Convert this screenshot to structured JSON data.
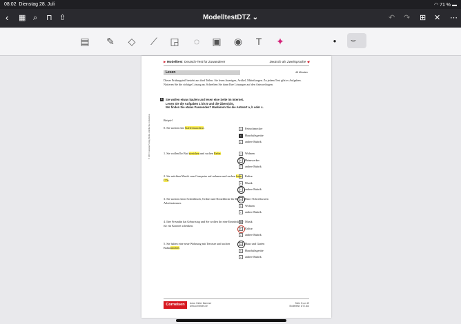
{
  "status": {
    "time": "08:02",
    "date": "Dienstag 28. Juli",
    "battery": "71 %"
  },
  "nav": {
    "title": "ModelltestDTZ",
    "title_chevron": "⌄"
  },
  "header": {
    "left_bold": "Modelltest",
    "left_text": "Deutsch-Test für Zuwanderer",
    "right": "Deutsch als Zweitsprache"
  },
  "section": {
    "title": "Lesen",
    "minutes": "45 Minuten"
  },
  "intro": "Dieser Prüfungsteil besteht aus fünf Teilen. Sie lesen Anzeigen, Artikel, Mitteilungen. Zu jedem Text gibt es Aufgaben. Notieren Sie die richtige Lösung an. Schreiben Sie dann Ihre Lösungen auf den Antwortbogen.",
  "task": {
    "number": "1",
    "line1": "Sie wollen etwas kaufen und lesen eine Seite im Internet.",
    "line2": "Lesen Sie die Aufgaben 1 bis 5 und die Übersicht.",
    "line3": "Wo finden Sie etwas Passendes? Markieren Sie die Antwort a, b oder c."
  },
  "beispiel": "Beispiel",
  "side_text": "© 2009 Cornelsen Verlag, Berlin. Alle Rechte vorbehalten.",
  "questions": [
    {
      "pre": "0.  Sie suchen eine ",
      "hl": "Kaffeemaschine",
      "post": ".",
      "options": [
        {
          "letter": "a",
          "text": "Feinschmecker"
        },
        {
          "letter": "b",
          "text": "Haushaltsgeräte"
        },
        {
          "letter": "c",
          "text": "andere Rubrik"
        }
      ]
    },
    {
      "pre": "1.  Sie wollen Ihr Bad ",
      "hl": "streichen",
      "mid": " und suchen ",
      "hl2": "Farbe",
      "post": ".",
      "options": [
        {
          "letter": "a",
          "text": "Wohnen"
        },
        {
          "letter": "b",
          "text": "Heimwerker"
        },
        {
          "letter": "c",
          "text": "andere Rubrik"
        }
      ]
    },
    {
      "pre": "2.  Sie möchten Musik vom Computer auf-nehmen und suchen ",
      "hl": "leere CDs",
      "post": ".",
      "options": [
        {
          "letter": "a",
          "text": "Kultur"
        },
        {
          "letter": "b",
          "text": "Musik"
        },
        {
          "letter": "c",
          "text": "andere Rubrik"
        }
      ]
    },
    {
      "pre": "3.  Sie suchen einen Schreibtisch, Ordner und Notizblöcke für Ihr Arbeitszimmer.",
      "options": [
        {
          "letter": "a",
          "text": "Büro-/Schreibwaren"
        },
        {
          "letter": "b",
          "text": "Wohnen"
        },
        {
          "letter": "c",
          "text": "andere Rubrik"
        }
      ]
    },
    {
      "pre": "4.  Ihre Freundin hat Geburtstag und Sie wollen ihr eine Eintrittskarte für ein Konzert schenken.",
      "options": [
        {
          "letter": "a",
          "text": "Musik"
        },
        {
          "letter": "b",
          "text": "Kultur"
        },
        {
          "letter": "c",
          "text": "andere Rubrik"
        }
      ]
    },
    {
      "pre": "5.  Sie haben eine neue Wohnung mit Terrasse und suchen Balko",
      "hl": "nmöbel",
      "post": ".",
      "options": [
        {
          "letter": "a",
          "text": "Haus und Garten"
        },
        {
          "letter": "b",
          "text": "Haushaltsgeräte"
        },
        {
          "letter": "c",
          "text": "andere Rubrik"
        }
      ]
    }
  ],
  "footer": {
    "logo": "Cornelsen",
    "author": "Autor: Dieter Maenner",
    "web": "www.cornelsen.de",
    "page": "Seite 5 von 19",
    "code": "Modelltest: DTZ.doc"
  }
}
